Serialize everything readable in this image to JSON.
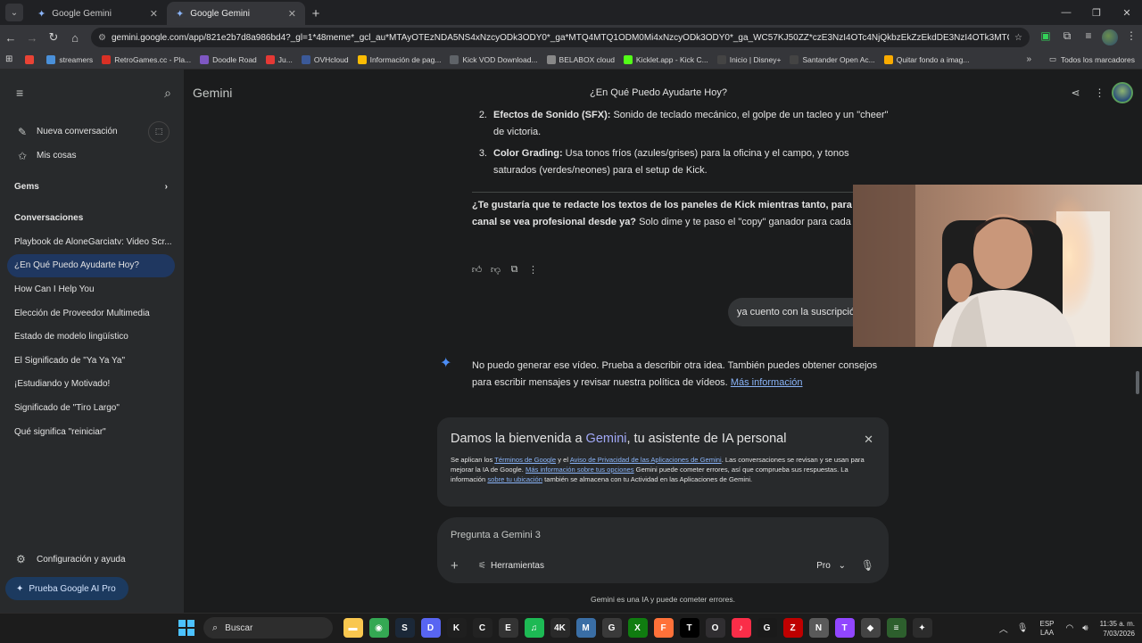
{
  "browser": {
    "tabs": [
      {
        "title": "Google Gemini",
        "active": false
      },
      {
        "title": "Google Gemini",
        "active": true
      }
    ],
    "url": "gemini.google.com/app/821e2b7d8a986bd4?_gl=1*48meme*_gcl_au*MTAyOTEzNDA5NS4xNzcyODk3ODY0*_ga*MTQ4MTQ1ODM0Mi4xNzcyODk3ODY0*_ga_WC57KJ50ZZ*czE3NzI4OTc4NjQkbzEkZzEkdDE3NzI4OTk3MTQkajckbDAkaDA.",
    "bookmarks": [
      {
        "label": "",
        "icon": "gmail-icon",
        "color": "#ea4335"
      },
      {
        "label": "streamers",
        "icon": "streamers-icon",
        "color": "#4a90d9"
      },
      {
        "label": "RetroGames.cc - Pla...",
        "icon": "retrogames-icon",
        "color": "#d93025"
      },
      {
        "label": "Doodle Road",
        "icon": "doodle-icon",
        "color": "#7e57c2"
      },
      {
        "label": "Ju...",
        "icon": "ju-icon",
        "color": "#e53935"
      },
      {
        "label": "OVHcloud",
        "icon": "ovh-icon",
        "color": "#3b5998"
      },
      {
        "label": "Información de pag...",
        "icon": "info-icon",
        "color": "#fbbc04"
      },
      {
        "label": "Kick VOD Download...",
        "icon": "kick-vod-icon",
        "color": "#5f6368"
      },
      {
        "label": "BELABOX cloud",
        "icon": "belabox-icon",
        "color": "#888888"
      },
      {
        "label": "Kicklet.app - Kick C...",
        "icon": "kicklet-icon",
        "color": "#53fc18"
      },
      {
        "label": "Inicio | Disney+",
        "icon": "disney-icon",
        "color": "#444444"
      },
      {
        "label": "Santander Open Ac...",
        "icon": "santander-icon",
        "color": "#444444"
      },
      {
        "label": "Quitar fondo a imag...",
        "icon": "removebg-icon",
        "color": "#f9ab00"
      }
    ],
    "all_bookmarks": "Todos los marcadores"
  },
  "sidebar": {
    "new_chat": "Nueva conversación",
    "my_stuff": "Mis cosas",
    "gems": "Gems",
    "conversations_title": "Conversaciones",
    "conversations": [
      {
        "label": "Playbook de AloneGarciatv: Video Scr...",
        "active": false
      },
      {
        "label": "¿En Qué Puedo Ayudarte Hoy?",
        "active": true
      },
      {
        "label": "How Can I Help You",
        "active": false
      },
      {
        "label": "Elección de Proveedor Multimedia",
        "active": false
      },
      {
        "label": "Estado de modelo lingüístico",
        "active": false
      },
      {
        "label": "El Significado de \"Ya Ya Ya\"",
        "active": false
      },
      {
        "label": "¡Estudiando y Motivado!",
        "active": false
      },
      {
        "label": "Significado de \"Tiro Largo\"",
        "active": false
      },
      {
        "label": "Qué significa \"reiniciar\"",
        "active": false
      }
    ],
    "settings": "Configuración y ayuda",
    "try_pro": "Prueba Google AI Pro"
  },
  "header": {
    "brand": "Gemini",
    "chat_title": "¿En Qué Puedo Ayudarte Hoy?"
  },
  "response": {
    "items": [
      {
        "num": "2.",
        "bold": "Efectos de Sonido (SFX):",
        "text": " Sonido de teclado mecánico, el golpe de un tacleo y un \"cheer\" de victoria."
      },
      {
        "num": "3.",
        "bold": "Color Grading:",
        "text": " Usa tonos fríos (azules/grises) para la oficina y el campo, y tonos saturados (verdes/neones) para el setup de Kick."
      }
    ],
    "question_bold": "¿Te gustaría que te redacte los textos de los paneles de Kick mientras tanto, para que tu canal se vea profesional desde ya?",
    "question_text": " Solo dime y te paso el \"copy\" ganador para cada sección."
  },
  "user_message": "ya cuento con la suscripción",
  "reply": {
    "text": "No puedo generar ese vídeo. Prueba a describir otra idea. También puedes obtener consejos para escribir mensajes y revisar nuestra política de vídeos.",
    "link": "Más información"
  },
  "welcome": {
    "title_prefix": "Damos la bienvenida a ",
    "title_brand": "Gemini",
    "title_suffix": ", tu asistente de IA personal",
    "b1": "Se aplican los ",
    "l1": "Términos de Google",
    "b2": " y el ",
    "l2": "Aviso de Privacidad de las Aplicaciones de Gemini",
    "b3": ". Las conversaciones se revisan y se usan para mejorar la IA de Google. ",
    "l3": "Más información sobre tus opciones",
    "b4": " Gemini puede cometer errores, así que comprueba sus respuestas. La información ",
    "l4": "sobre tu ubicación",
    "b5": " también se almacena con tu Actividad en las Aplicaciones de Gemini."
  },
  "input": {
    "placeholder": "Pregunta a Gemini 3",
    "tools": "Herramientas",
    "model": "Pro"
  },
  "disclaimer": "Gemini es una IA y puede cometer errores.",
  "taskbar": {
    "search": "Buscar",
    "lang_top": "ESP",
    "lang_bottom": "LAA",
    "time": "11:35 a. m.",
    "date": "7/03/2026",
    "apps": [
      {
        "name": "file-explorer-icon",
        "glyph": "▬",
        "color": "#f9c74f"
      },
      {
        "name": "chrome-icon",
        "glyph": "◉",
        "color": "#34a853"
      },
      {
        "name": "steam-icon",
        "glyph": "S",
        "color": "#1b2838"
      },
      {
        "name": "discord-icon",
        "glyph": "D",
        "color": "#5865f2"
      },
      {
        "name": "kick-icon",
        "glyph": "K",
        "color": "#1f1f1f"
      },
      {
        "name": "capcut-icon",
        "glyph": "C",
        "color": "#222222"
      },
      {
        "name": "epic-icon",
        "glyph": "E",
        "color": "#333333"
      },
      {
        "name": "spotify-icon",
        "glyph": "♫",
        "color": "#1db954"
      },
      {
        "name": "4k-icon",
        "glyph": "4K",
        "color": "#2a2a2a"
      },
      {
        "name": "media-icon",
        "glyph": "M",
        "color": "#3a6ea5"
      },
      {
        "name": "google-icon",
        "glyph": "G",
        "color": "#3a3a3a"
      },
      {
        "name": "xbox-icon",
        "glyph": "X",
        "color": "#107c10"
      },
      {
        "name": "firefox-icon",
        "glyph": "F",
        "color": "#ff7139"
      },
      {
        "name": "tiktok-icon",
        "glyph": "T",
        "color": "#000000"
      },
      {
        "name": "obs-icon",
        "glyph": "O",
        "color": "#302e31"
      },
      {
        "name": "music-icon",
        "glyph": "♪",
        "color": "#fa2d48"
      },
      {
        "name": "g-hub-icon",
        "glyph": "G",
        "color": "#1a1a1a"
      },
      {
        "name": "filezilla-icon",
        "glyph": "Z",
        "color": "#bf0000"
      },
      {
        "name": "notepad-icon",
        "glyph": "N",
        "color": "#5a5a5a"
      },
      {
        "name": "twitch-icon",
        "glyph": "T",
        "color": "#9146ff"
      },
      {
        "name": "app-icon",
        "glyph": "◆",
        "color": "#444444"
      },
      {
        "name": "app2-icon",
        "glyph": "≡",
        "color": "#2d5f2d"
      },
      {
        "name": "davinci-icon",
        "glyph": "✦",
        "color": "#2c2c2c"
      }
    ]
  }
}
